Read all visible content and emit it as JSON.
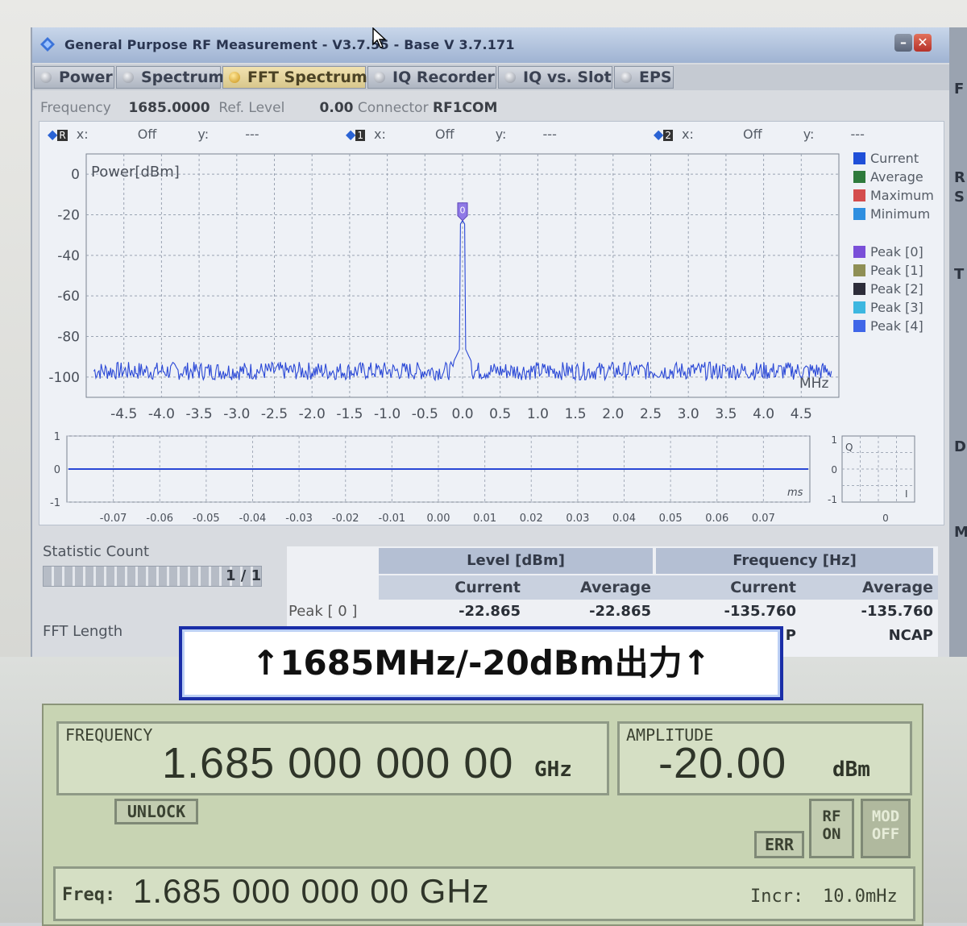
{
  "window": {
    "title": "General Purpose RF Measurement  - V3.7.55 - Base V 3.7.171",
    "minimize_label": "–",
    "close_label": "✕"
  },
  "tabs": [
    {
      "label": "Power",
      "active": false
    },
    {
      "label": "Spectrum",
      "active": false
    },
    {
      "label": "FFT Spectrum",
      "active": true
    },
    {
      "label": "IQ Recorder",
      "active": false
    },
    {
      "label": "IQ vs. Slot",
      "active": false
    },
    {
      "label": "EPS",
      "active": false
    }
  ],
  "info": {
    "frequency_label": "Frequency",
    "frequency_value": "1685.0000",
    "ref_level_label": "Ref. Level",
    "ref_level_value": "0.00",
    "connector_label": "Connector",
    "connector_value": "RF1COM"
  },
  "markers": [
    {
      "tag": "R",
      "x_label": "x:",
      "x_value": "Off",
      "y_label": "y:",
      "y_value": "---"
    },
    {
      "tag": "1",
      "x_label": "x:",
      "x_value": "Off",
      "y_label": "y:",
      "y_value": "---"
    },
    {
      "tag": "2",
      "x_label": "x:",
      "x_value": "Off",
      "y_label": "y:",
      "y_value": "---"
    }
  ],
  "legend": {
    "traces": [
      {
        "label": "Current",
        "color": "#1f4fd8"
      },
      {
        "label": "Average",
        "color": "#2e7a3c"
      },
      {
        "label": "Maximum",
        "color": "#d44d4d"
      },
      {
        "label": "Minimum",
        "color": "#2f8fe0"
      }
    ],
    "peaks": [
      {
        "label": "Peak [0]",
        "color": "#7a4fd8"
      },
      {
        "label": "Peak [1]",
        "color": "#8f8f55"
      },
      {
        "label": "Peak [2]",
        "color": "#2d2d3a"
      },
      {
        "label": "Peak [3]",
        "color": "#3db7e0"
      },
      {
        "label": "Peak [4]",
        "color": "#3f66e8"
      }
    ]
  },
  "chart_data": [
    {
      "type": "line",
      "ylabel": "Power[dBm]",
      "xlabel": "MHz",
      "xlim": [
        -5.0,
        5.0
      ],
      "ylim": [
        -110,
        10
      ],
      "x_ticks": [
        -4.5,
        -4.0,
        -3.5,
        -3.0,
        -2.5,
        -2.0,
        -1.5,
        -1.0,
        -0.5,
        0.0,
        0.5,
        1.0,
        1.5,
        2.0,
        2.5,
        3.0,
        3.5,
        4.0,
        4.5
      ],
      "x_tick_labels": [
        "-4.5",
        "-4.0",
        "-3.5",
        "-3.0",
        "-2.5",
        "-2.0",
        "-1.5",
        "-1.0",
        "-0.5",
        "0.0",
        "0.5",
        "1.0",
        "1.5",
        "2.0",
        "2.5",
        "3.0",
        "3.5",
        "4.0",
        "4.5"
      ],
      "y_ticks": [
        0,
        -20,
        -40,
        -60,
        -80,
        -100
      ],
      "y_tick_labels": [
        "0",
        "-20",
        "-40",
        "-60",
        "-80",
        "-100"
      ],
      "grid": true,
      "series": [
        {
          "name": "Current",
          "color": "#2a48d6",
          "noise_floor": -97,
          "peak_x": 0.0,
          "peak_y": -22.865
        }
      ],
      "peak_markers": [
        {
          "label": "0",
          "x": 0.0,
          "y": -22.865
        }
      ]
    },
    {
      "type": "line",
      "xlabel": "ms",
      "xlim": [
        -0.08,
        0.08
      ],
      "ylim": [
        -1,
        1
      ],
      "x_ticks": [
        -0.07,
        -0.06,
        -0.05,
        -0.04,
        -0.03,
        -0.02,
        -0.01,
        0.0,
        0.01,
        0.02,
        0.03,
        0.04,
        0.05,
        0.06,
        0.07
      ],
      "x_tick_labels": [
        "-0.07",
        "-0.06",
        "-0.05",
        "-0.04",
        "-0.03",
        "-0.02",
        "-0.01",
        "0.00",
        "0.01",
        "0.02",
        "0.03",
        "0.04",
        "0.05",
        "0.06",
        "0.07"
      ],
      "y_ticks": [
        1,
        0,
        -1
      ],
      "y_tick_labels": [
        "1",
        "0",
        "-1"
      ],
      "grid": true,
      "series": [
        {
          "values_constant": 0.0,
          "color": "#2a48d6"
        }
      ]
    },
    {
      "type": "scatter",
      "xlim": [
        -1,
        1
      ],
      "ylim": [
        -1,
        1
      ],
      "x_tick_labels": [
        "0"
      ],
      "y_tick_labels": [
        "1",
        "0",
        "-1"
      ],
      "axis_label_q": "Q",
      "axis_label_i": "I",
      "grid": true
    }
  ],
  "stats": {
    "statistic_count_label": "Statistic Count",
    "statistic_count_value": "1 / 1",
    "statistic_progress": 1.0,
    "fft_length_label": "FFT Length"
  },
  "results": {
    "level_header": "Level [dBm]",
    "frequency_header": "Frequency [Hz]",
    "sub_headers": [
      "Current",
      "Average",
      "Current",
      "Average"
    ],
    "row_label": "Peak [ 0 ]",
    "row_values": [
      "-22.865",
      "-22.865",
      "-135.760",
      "-135.760"
    ],
    "row2_values": [
      "P",
      "NCAP"
    ]
  },
  "side_strip": [
    "F",
    "R",
    "S",
    "T",
    "D",
    "M"
  ],
  "banner": {
    "text": "↑1685MHz/-20dBm出力↑"
  },
  "generator": {
    "frequency_label": "FREQUENCY",
    "frequency_value": "1.685 000 000 00",
    "frequency_unit": "GHz",
    "amplitude_label": "AMPLITUDE",
    "amplitude_value": "-20.00",
    "amplitude_unit": "dBm",
    "unlock_label": "UNLOCK",
    "err_label": "ERR",
    "rf_label_top": "RF",
    "rf_label_bottom": "ON",
    "mod_label_top": "MOD",
    "mod_label_bottom": "OFF",
    "freq_entry_label": "Freq:",
    "freq_entry_value": "1.685 000 000 00 GHz",
    "incr_label": "Incr:",
    "incr_value": "10.0mHz"
  }
}
